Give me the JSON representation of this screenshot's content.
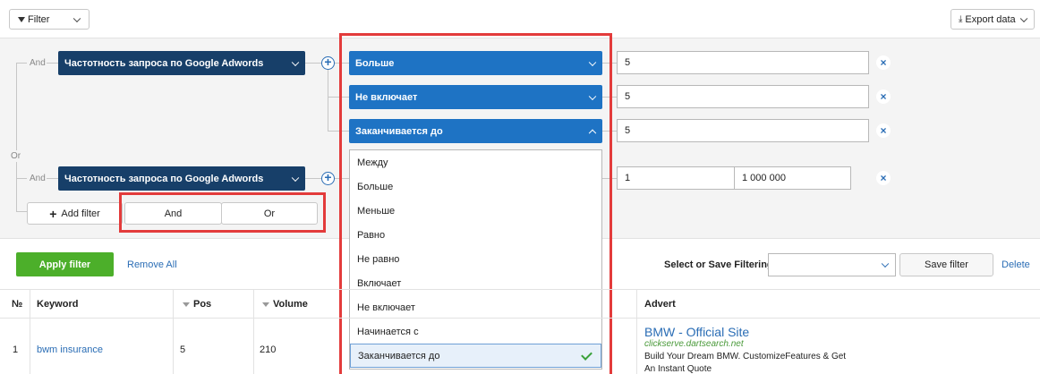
{
  "toolbar": {
    "filter_label": "Filter",
    "export_label": "Export data"
  },
  "builder": {
    "group_tag_and": "And",
    "group_tag_or": "Or",
    "row1": {
      "field": "Частотность запроса по Google Adwords",
      "conditions": [
        {
          "op": "Больше",
          "value": "5"
        },
        {
          "op": "Не включает",
          "value": "5"
        },
        {
          "op": "Заканчивается до",
          "value": "5"
        }
      ]
    },
    "row2": {
      "field": "Частотность запроса по Google Adwords",
      "value_from": "1",
      "value_to": "1 000 000"
    },
    "add_filter_label": "Add filter",
    "and_label": "And",
    "or_label": "Or"
  },
  "operator_menu": {
    "items": [
      "Между",
      "Больше",
      "Меньше",
      "Равно",
      "Не равно",
      "Включает",
      "Не включает",
      "Начинается с",
      "Заканчивается до"
    ],
    "selected": "Заканчивается до"
  },
  "actions": {
    "apply_label": "Apply filter",
    "remove_all_label": "Remove All",
    "select_save_label": "Select or Save Filtering:",
    "save_filter_label": "Save filter",
    "delete_label": "Delete"
  },
  "table": {
    "headers": {
      "num": "№",
      "keyword": "Keyword",
      "pos": "Pos",
      "volume": "Volume",
      "advert": "Advert"
    },
    "row": {
      "num": "1",
      "keyword": "bwm insurance",
      "pos": "5",
      "volume": "210",
      "ad_title": "BMW - Official Site",
      "ad_url": "clickserve.dartsearch.net",
      "ad_text_1": "Build Your Dream BMW. CustomizeFeatures & Get",
      "ad_text_2": "An Instant Quote"
    }
  },
  "colors": {
    "dark_blue": "#173f69",
    "blue": "#1e73c4",
    "green": "#4caf2a",
    "highlight_red": "#e33b3b"
  }
}
